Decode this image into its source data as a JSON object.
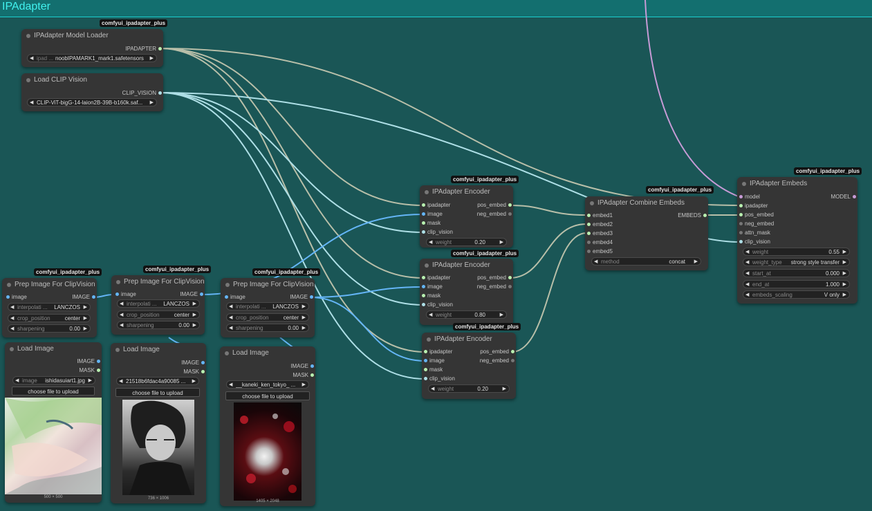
{
  "group": {
    "title": "IPAdapter"
  },
  "badge_text": "comfyui_ipadapter_plus",
  "colors": {
    "canvas": "#1a5656",
    "header": "#136f6f",
    "ipadapter_wire": "#b8bfa9",
    "clip_wire": "#aedfe6",
    "image_wire": "#64b5f6",
    "model_wire": "#c79bd6"
  },
  "model_loader": {
    "title": "IPAdapter Model Loader",
    "out": "IPADAPTER",
    "widget_label": "ipad ...",
    "widget_value": "noobIPAMARK1_mark1.safetensors"
  },
  "clip_loader": {
    "title": "Load CLIP Vision",
    "out": "CLIP_VISION",
    "widget_value": "CLIP-ViT-bigG-14-laion2B-39B-b160k.saf..."
  },
  "prep": {
    "title": "Prep Image For ClipVision",
    "in": "image",
    "out": "IMAGE",
    "interp_label": "interpolati ...",
    "interp_value": "LANCZOS",
    "crop_label": "crop_position",
    "crop_value": "center",
    "sharp_label": "sharpening",
    "sharp_value": "0.00"
  },
  "load_image": {
    "title": "Load Image",
    "out1": "IMAGE",
    "out2": "MASK",
    "upload": "choose file to upload",
    "widget_label": "image",
    "items": [
      {
        "file": "ishidasuiart1.jpg",
        "dims": "500 × 500"
      },
      {
        "file": "21518b6fdac4a90085 ...",
        "dims": "736 × 1006"
      },
      {
        "file": "__kaneki_ken_tokyo_ ...",
        "dims": "1405 × 2048"
      }
    ]
  },
  "encoder": {
    "title": "IPAdapter Encoder",
    "inputs": [
      "ipadapter",
      "image",
      "mask",
      "clip_vision"
    ],
    "out1": "pos_embed",
    "out2": "neg_embed",
    "weight_label": "weight",
    "weights": [
      "0.20",
      "0.80",
      "0.20"
    ]
  },
  "combine": {
    "title": "IPAdapter Combine Embeds",
    "inputs": [
      "embed1",
      "embed2",
      "embed3",
      "embed4",
      "embed5"
    ],
    "out": "EMBEDS",
    "method_label": "method",
    "method_value": "concat"
  },
  "embeds": {
    "title": "IPAdapter Embeds",
    "inputs": [
      "model",
      "ipadapter",
      "pos_embed",
      "neg_embed",
      "attn_mask",
      "clip_vision"
    ],
    "out": "MODEL",
    "widgets": [
      {
        "label": "weight",
        "value": "0.55"
      },
      {
        "label": "weight_type",
        "value": "strong style transfer"
      },
      {
        "label": "start_at",
        "value": "0.000"
      },
      {
        "label": "end_at",
        "value": "1.000"
      },
      {
        "label": "embeds_scaling",
        "value": "V only"
      }
    ]
  }
}
